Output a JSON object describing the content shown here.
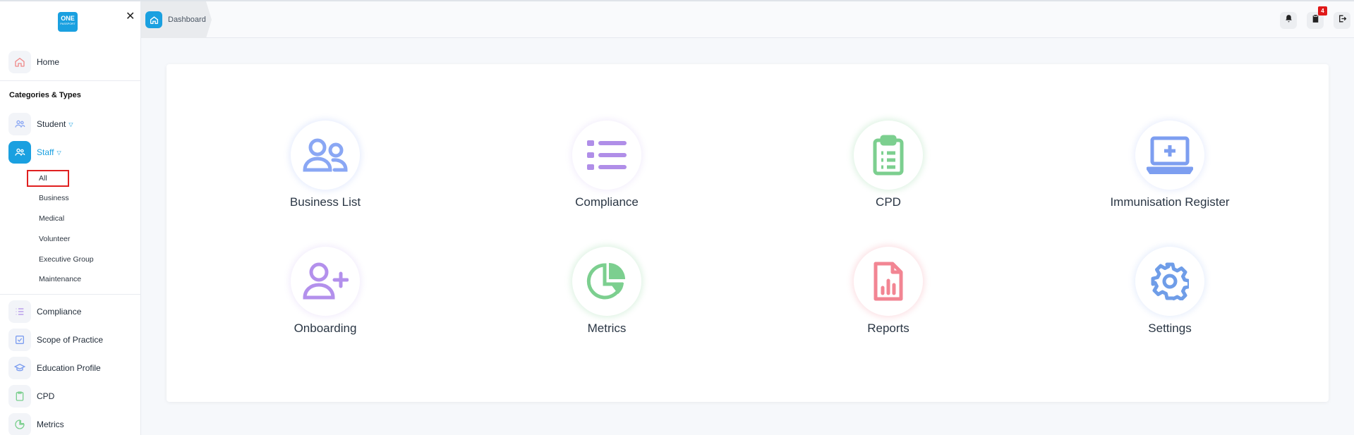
{
  "sidebar": {
    "logo": {
      "line1": "ONE",
      "line2": "PASSPORT"
    },
    "home_label": "Home",
    "section_title": "Categories & Types",
    "student_label": "Student",
    "staff_label": "Staff",
    "staff_sub": [
      "All",
      "Business",
      "Medical",
      "Volunteer",
      "Executive Group",
      "Maintenance"
    ],
    "bottom_items": [
      "Compliance",
      "Scope of Practice",
      "Education Profile",
      "CPD",
      "Metrics"
    ]
  },
  "topbar": {
    "breadcrumb": "Dashboard",
    "badge_count": "4"
  },
  "tiles": [
    {
      "label": "Business List",
      "icon": "users-icon",
      "color": "#8aa7f4"
    },
    {
      "label": "Compliance",
      "icon": "list-icon",
      "color": "#b08ee8"
    },
    {
      "label": "CPD",
      "icon": "clipboard-icon",
      "color": "#7ccf8f"
    },
    {
      "label": "Immunisation Register",
      "icon": "laptop-plus-icon",
      "color": "#7d9ef0"
    },
    {
      "label": "Onboarding",
      "icon": "user-plus-icon",
      "color": "#b390ec"
    },
    {
      "label": "Metrics",
      "icon": "pie-chart-icon",
      "color": "#7ccf8f"
    },
    {
      "label": "Reports",
      "icon": "report-file-icon",
      "color": "#f28593"
    },
    {
      "label": "Settings",
      "icon": "gear-icon",
      "color": "#6f9de8"
    }
  ],
  "colors": {
    "accent": "#1aa0e0",
    "badge": "#e01919"
  }
}
